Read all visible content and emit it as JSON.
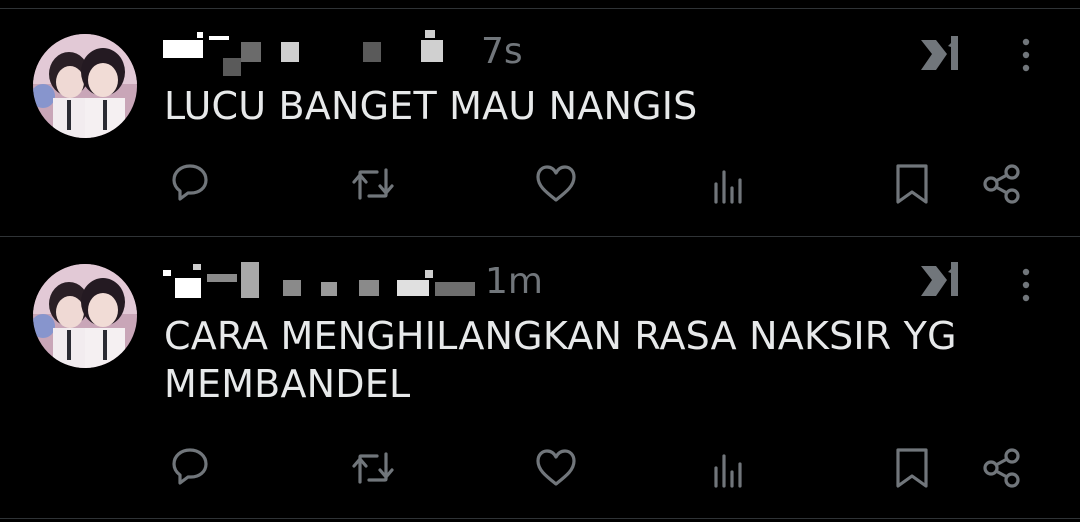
{
  "posts": [
    {
      "timestamp": "7s",
      "text": "LUCU BANGET MAU NANGIS"
    },
    {
      "timestamp": "1m",
      "text": "CARA MENGHILANGKAN RASA NAKSIR YG MEMBANDEL"
    }
  ],
  "icons": {
    "reply": "reply-icon",
    "repost": "repost-icon",
    "like": "like-icon",
    "views": "views-icon",
    "bookmark": "bookmark-icon",
    "share": "share-icon",
    "grok": "grok-icon",
    "more": "more-icon"
  },
  "colors": {
    "background": "#000000",
    "text": "#e7e9ea",
    "secondary": "#71767b",
    "divider": "#2f3336"
  }
}
